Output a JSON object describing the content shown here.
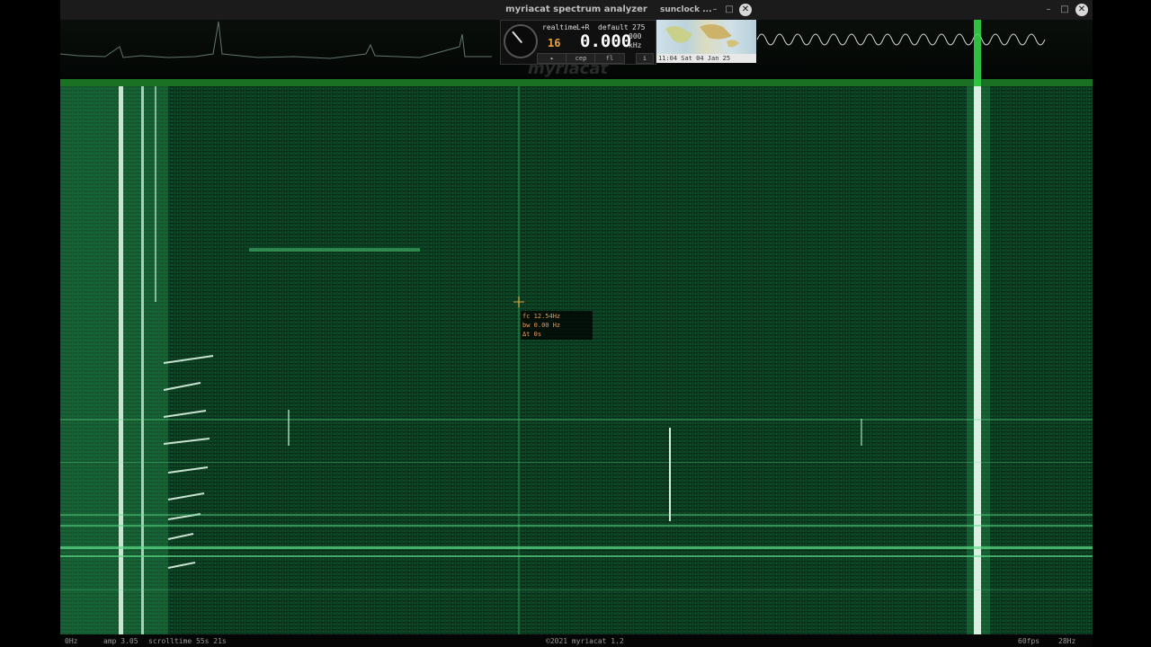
{
  "window": {
    "title": "myriacat spectrum analyzer",
    "controls": {
      "minimize": "–",
      "maximize": "□",
      "close": "✕"
    }
  },
  "panel": {
    "mode": "realtime",
    "channels": "L+R",
    "preset": "default",
    "preset_num": "275",
    "small_digits": "16",
    "frequency": "0.000",
    "freq_decimals": "000",
    "unit": "kHz",
    "buttons": [
      "▸",
      "cep",
      "fl",
      "i"
    ]
  },
  "watermark": "myriacat",
  "sunclock": {
    "title": "sunclock ...",
    "controls": {
      "minimize": "–",
      "maximize": "□",
      "close": "✕"
    },
    "datetime": "11:04 Sat 04 Jan 25"
  },
  "cursor": {
    "frequency": "fc 12.54Hz",
    "bandwidth": "bw 0.00 Hz",
    "delta_time": "Δt 0s"
  },
  "status": {
    "left_freq": "0Hz",
    "amp": "amp 3.05",
    "scrolltime": "scrolltime 55s 21s",
    "copyright": "©2021 myriacat 1.2",
    "fps": "60fps",
    "right_freq": "28Hz"
  },
  "icons": {
    "gauge": "gauge-dial-icon",
    "crosshair": "crosshair-icon",
    "close": "close-icon"
  },
  "colors": {
    "spectrum": "#35e04a",
    "waterfall_bg": "#0b2a18",
    "accent": "#e8a23a"
  }
}
